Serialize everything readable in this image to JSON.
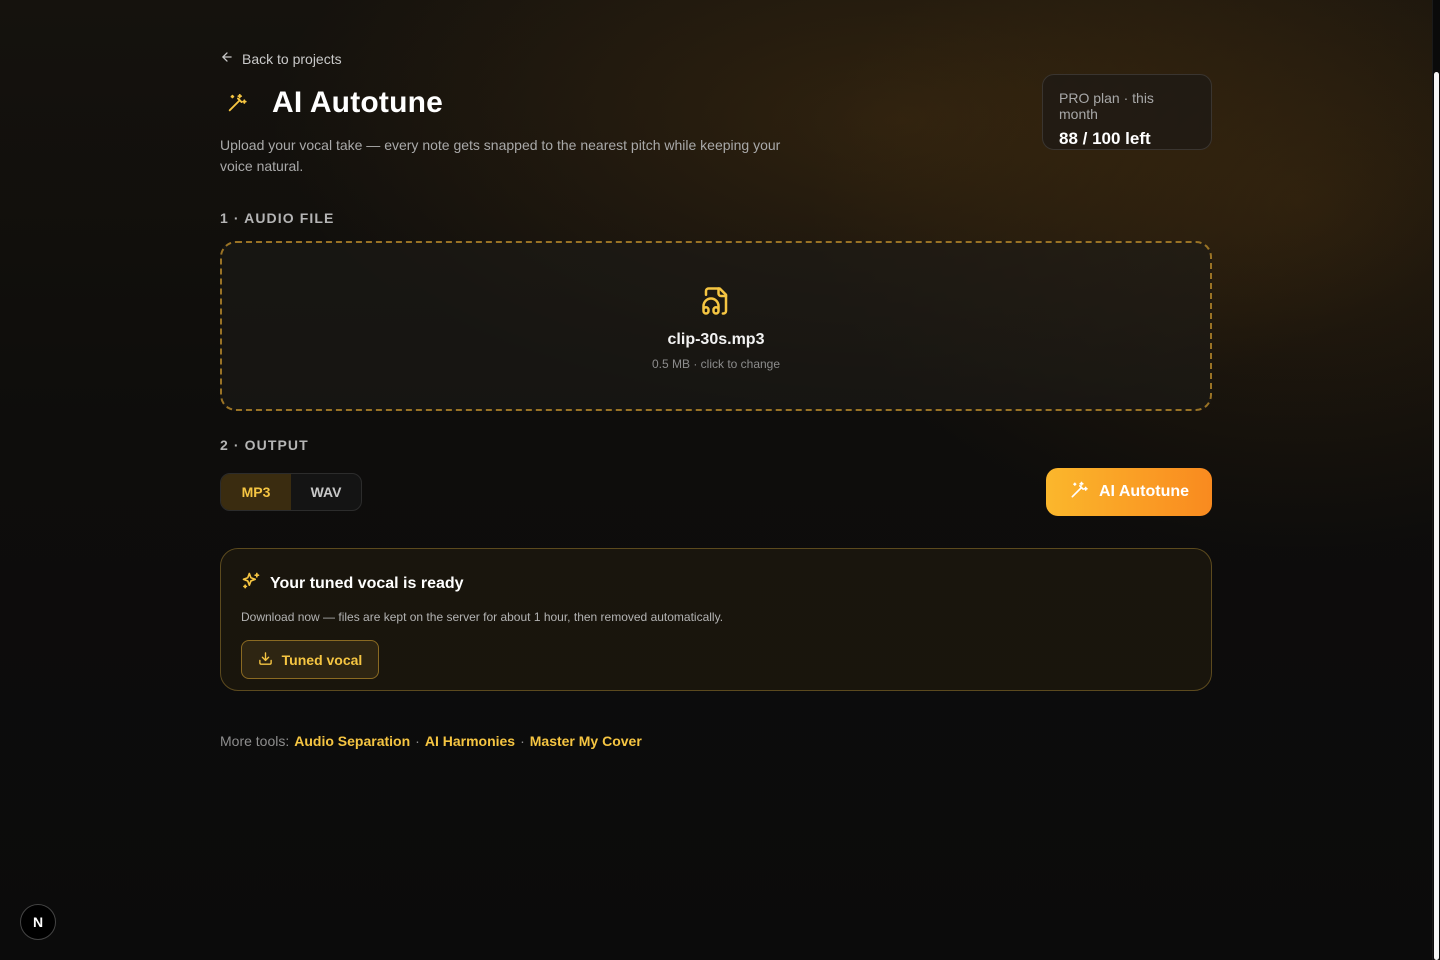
{
  "nav": {
    "back_label": "Back to projects"
  },
  "header": {
    "title": "AI Autotune",
    "subtitle": "Upload your vocal take — every note gets snapped to the nearest pitch while keeping your voice natural."
  },
  "plan": {
    "label": "PRO plan · this month",
    "remaining": "88 / 100 left"
  },
  "sections": {
    "audio_label": "1 · AUDIO FILE",
    "output_label": "2 · OUTPUT"
  },
  "file": {
    "name": "clip-30s.mp3",
    "meta": "0.5 MB · click to change",
    "icon": "file-audio-icon"
  },
  "output": {
    "formats": [
      "MP3",
      "WAV"
    ],
    "selected": "MP3",
    "run_label": "AI Autotune"
  },
  "result": {
    "title": "Your tuned vocal is ready",
    "description": "Download now — files are kept on the server for about 1 hour, then removed automatically.",
    "download_label": "Tuned vocal"
  },
  "more_tools": {
    "label": "More tools:",
    "links": [
      "Audio Separation",
      "AI Harmonies",
      "Master My Cover"
    ]
  },
  "dev_badge": "N",
  "colors": {
    "accent": "#f5c542",
    "accent_orange": "#f98a1f",
    "background": "#0b0b0b"
  }
}
